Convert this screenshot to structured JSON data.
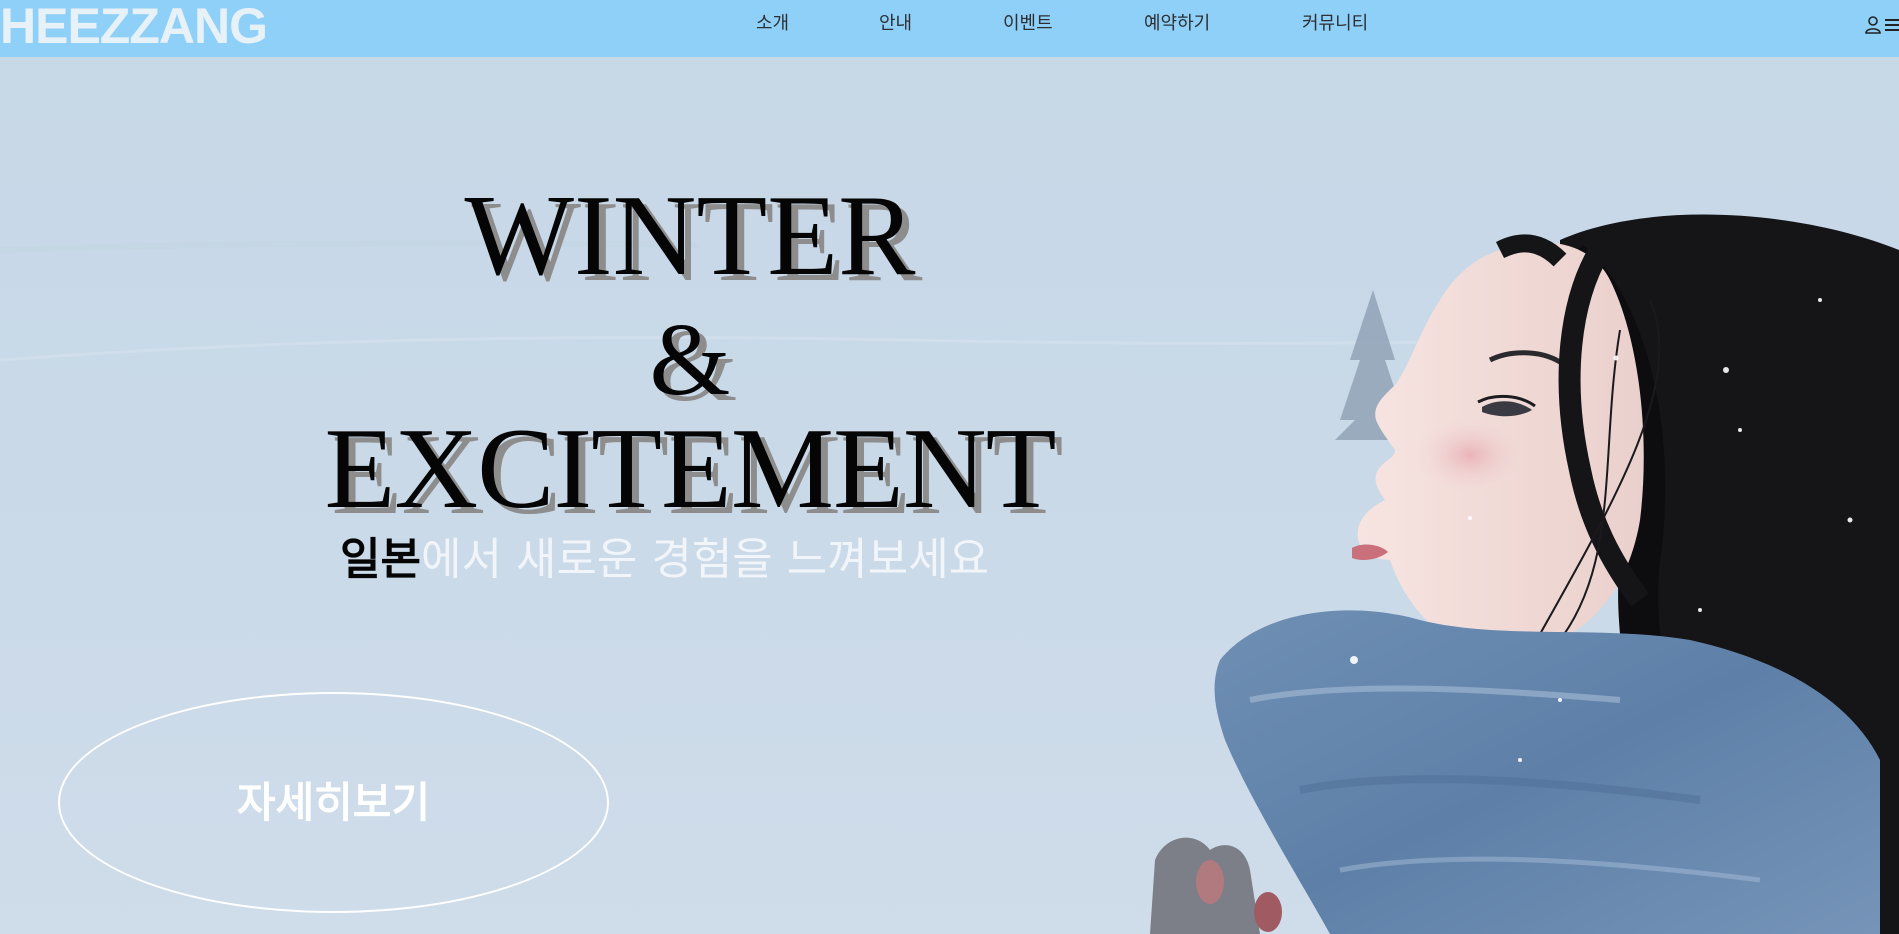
{
  "brand": {
    "logo_text": "HEEZZANG"
  },
  "nav": {
    "items": [
      {
        "label": "소개"
      },
      {
        "label": "안내"
      },
      {
        "label": "이벤트"
      },
      {
        "label": "예약하기"
      },
      {
        "label": "커뮤니티"
      }
    ],
    "icons": [
      "user-icon",
      "menu-icon"
    ]
  },
  "hero": {
    "headline_line1": "WINTER",
    "headline_line2": "&",
    "headline_line3": "EXCITEMENT",
    "subtitle_highlight": "일본",
    "subtitle_rest": "에서 새로운 경험을 느껴보세요",
    "cta_label": "자세히보기"
  },
  "colors": {
    "topbar": "#8fd0f8",
    "logo": "#e7f1f8",
    "nav_text": "#2d2f33",
    "headline": "#050505",
    "headline_shadow": "#8d8d8d",
    "subtitle_light": "#f1f5f9",
    "cta_border": "#ffffff"
  }
}
